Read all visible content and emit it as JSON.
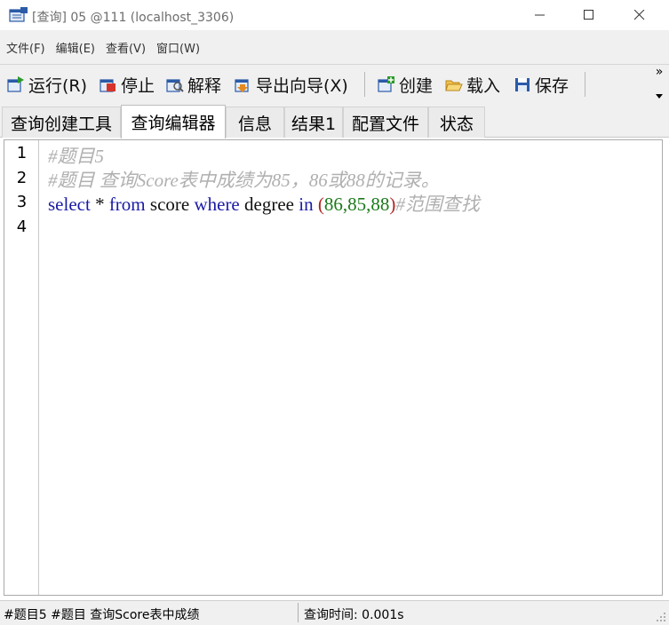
{
  "window": {
    "title": "[查询] 05 @111 (localhost_3306)"
  },
  "menu": {
    "items": [
      "文件(F)",
      "编辑(E)",
      "查看(V)",
      "窗口(W)"
    ]
  },
  "toolbar": {
    "run_label": "运行(R)",
    "stop_label": "停止",
    "explain_label": "解释",
    "export_label": "导出向导(X)",
    "create_label": "创建",
    "load_label": "载入",
    "save_label": "保存",
    "more_glyph": "»"
  },
  "tabs": [
    {
      "label": "查询创建工具"
    },
    {
      "label": "查询编辑器"
    },
    {
      "label": "信息"
    },
    {
      "label": "结果1"
    },
    {
      "label": "配置文件"
    },
    {
      "label": "状态"
    }
  ],
  "editor": {
    "line_numbers": [
      "1",
      "2",
      "3",
      "4"
    ],
    "line1": "#题目5",
    "line2": "#题目  查询Score表中成绩为85，86或88的记录。",
    "line3": {
      "select": "select",
      "star": " * ",
      "from": "from",
      "score": " score ",
      "where": "where",
      "degree": " degree ",
      "in": "in",
      "open_paren": " (",
      "values": "86,85,88",
      "close_paren": ")",
      "comment": "#范围查找"
    }
  },
  "status": {
    "left": "#题目5 #题目  查询Score表中成绩",
    "right": "查询时间: 0.001s"
  },
  "colors": {
    "keyword": "#1a1aa6",
    "comment": "#b0b0b0",
    "number": "#1a7a1a",
    "paren": "#b22222"
  }
}
